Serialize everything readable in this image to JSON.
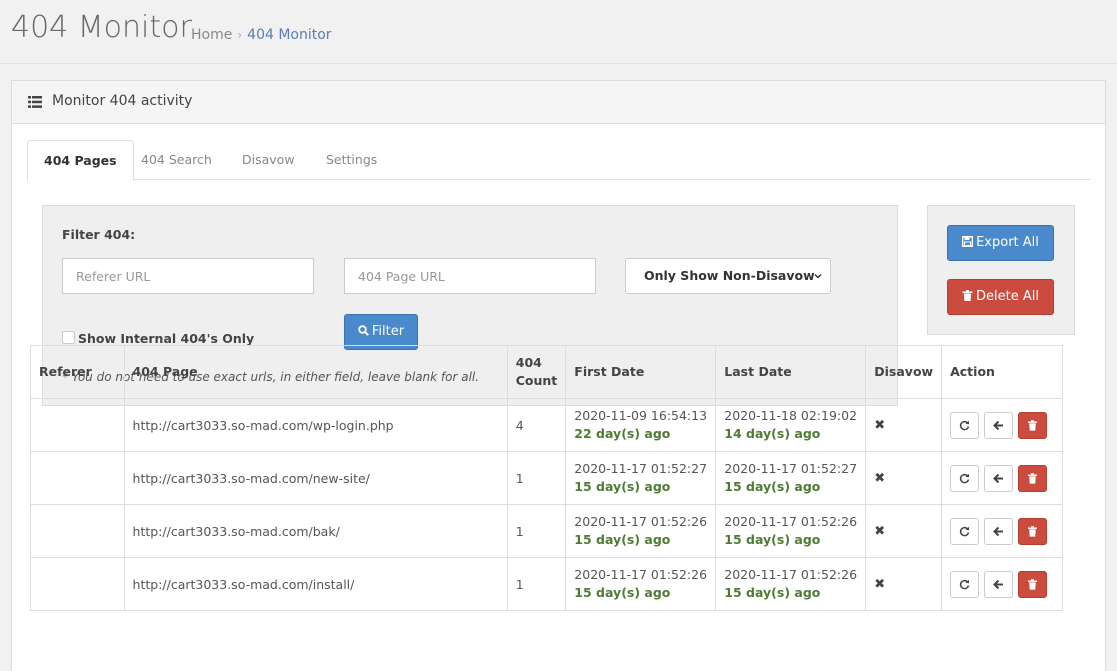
{
  "header": {
    "title": "404 Monitor",
    "breadcrumb": {
      "home": "Home",
      "separator": "›",
      "current": "404 Monitor"
    }
  },
  "panel": {
    "icon": "list-icon",
    "title": "Monitor 404 activity"
  },
  "tabs": [
    {
      "label": "404 Pages",
      "active": true
    },
    {
      "label": "404 Search",
      "active": false
    },
    {
      "label": "Disavow",
      "active": false
    },
    {
      "label": "Settings",
      "active": false
    }
  ],
  "filter": {
    "label": "Filter 404:",
    "referer_placeholder": "Referer URL",
    "page_placeholder": "404 Page URL",
    "select_value": "Only Show Non-Disavow",
    "checkbox_label": "Show Internal 404's Only",
    "filter_button": "Filter",
    "note": "* You do not need to use exact urls, in either field, leave blank for all."
  },
  "actions": {
    "export_label": "Export All",
    "delete_label": "Delete All"
  },
  "table": {
    "headers": {
      "referer": "Referer",
      "page": "404 Page",
      "count_line1": "404",
      "count_line2": "Count",
      "first_date": "First Date",
      "last_date": "Last Date",
      "disavow": "Disavow",
      "action": "Action"
    },
    "rows": [
      {
        "referer": "",
        "page": "http://cart3033.so-mad.com/wp-login.php",
        "count": "4",
        "first_date": "2020-11-09 16:54:13",
        "first_ago": "22 day(s) ago",
        "last_date": "2020-11-18 02:19:02",
        "last_ago": "14 day(s) ago",
        "disavow": "✖"
      },
      {
        "referer": "",
        "page": "http://cart3033.so-mad.com/new-site/",
        "count": "1",
        "first_date": "2020-11-17 01:52:27",
        "first_ago": "15 day(s) ago",
        "last_date": "2020-11-17 01:52:27",
        "last_ago": "15 day(s) ago",
        "disavow": "✖"
      },
      {
        "referer": "",
        "page": "http://cart3033.so-mad.com/bak/",
        "count": "1",
        "first_date": "2020-11-17 01:52:26",
        "first_ago": "15 day(s) ago",
        "last_date": "2020-11-17 01:52:26",
        "last_ago": "15 day(s) ago",
        "disavow": "✖"
      },
      {
        "referer": "",
        "page": "http://cart3033.so-mad.com/install/",
        "count": "1",
        "first_date": "2020-11-17 01:52:26",
        "first_ago": "15 day(s) ago",
        "last_date": "2020-11-17 01:52:26",
        "last_ago": "15 day(s) ago",
        "disavow": "✖"
      }
    ]
  },
  "colors": {
    "primary": "#4a89cc",
    "danger": "#cb4b3e",
    "success_text": "#4f7c35"
  }
}
